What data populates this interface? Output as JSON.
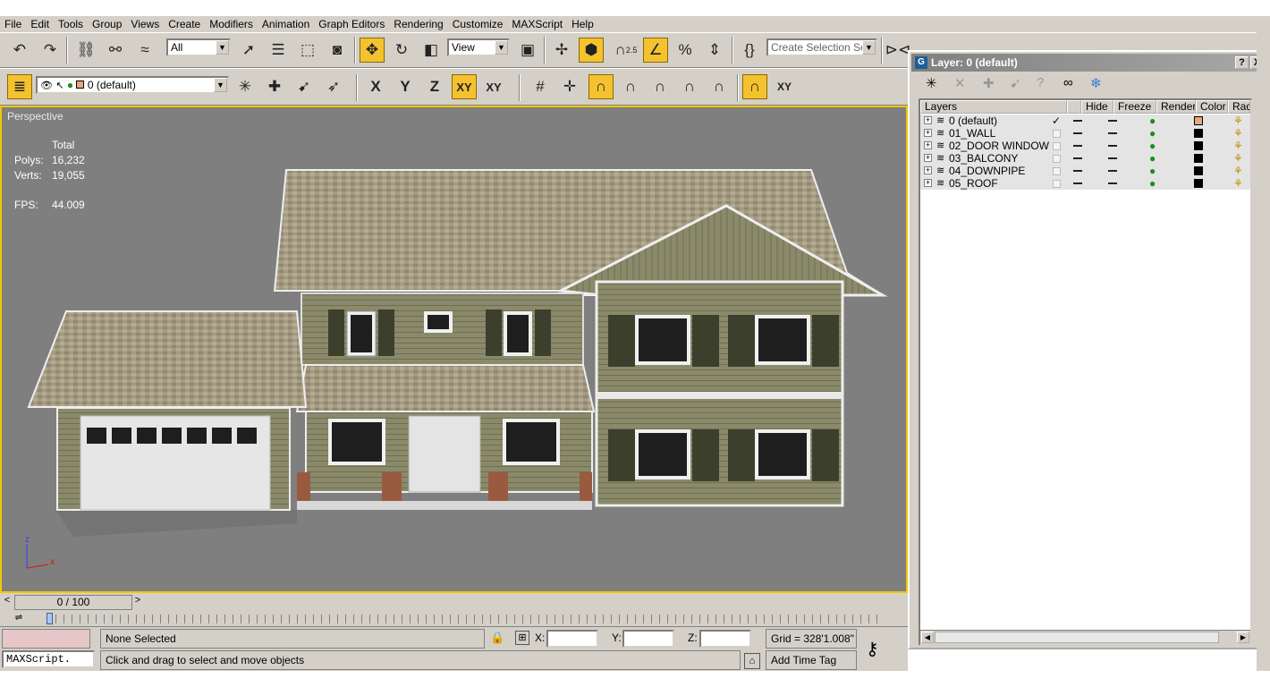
{
  "menu": [
    "File",
    "Edit",
    "Tools",
    "Group",
    "Views",
    "Create",
    "Modifiers",
    "Animation",
    "Graph Editors",
    "Rendering",
    "Customize",
    "MAXScript",
    "Help"
  ],
  "toolbar1": {
    "selection_filter": "All",
    "ref_coord": "View",
    "create_selection_set": "Create Selection Set",
    "snap_label": "2.5"
  },
  "toolbar2": {
    "current_layer": "0 (default)",
    "axis_labels": [
      "X",
      "Y",
      "Z",
      "XY",
      "XY"
    ]
  },
  "viewport": {
    "label": "Perspective",
    "stats_header": "Total",
    "polys_label": "Polys:",
    "polys": "16,232",
    "verts_label": "Verts:",
    "verts": "19,055",
    "fps_label": "FPS:",
    "fps": "44.009",
    "axis_z": "z",
    "axis_x": "x"
  },
  "timeline": {
    "position": "0 / 100",
    "prev": "<",
    "next": ">"
  },
  "status": {
    "selection": "None Selected",
    "prompt": "Click and drag to select and move objects",
    "maxscript": "MAXScript.",
    "x_label": "X:",
    "y_label": "Y:",
    "z_label": "Z:",
    "grid": "Grid = 328'1.008\"",
    "add_time_tag": "Add Time Tag"
  },
  "layer_panel": {
    "title": "Layer: 0 (default)",
    "help": "?",
    "close": "X",
    "columns": [
      "Layers",
      "Hide",
      "Freeze",
      "Render",
      "Color",
      "Radios"
    ],
    "rows": [
      {
        "name": "0 (default)",
        "current": true,
        "color": "#e8a67e"
      },
      {
        "name": "01_WALL",
        "current": false,
        "color": "#000000"
      },
      {
        "name": "02_DOOR WINDOW",
        "current": false,
        "color": "#000000"
      },
      {
        "name": "03_BALCONY",
        "current": false,
        "color": "#000000"
      },
      {
        "name": "04_DOWNPIPE",
        "current": false,
        "color": "#000000"
      },
      {
        "name": "05_ROOF",
        "current": false,
        "color": "#000000"
      }
    ]
  },
  "colors": {
    "ui_gray": "#d4d0c8",
    "viewport_bg": "#7f7f7f",
    "active_highlight": "#f4c22f",
    "viewport_border": "#f0c800",
    "wall_green": "#8a8a6a",
    "roof_tan": "#a89e84",
    "shutter_dark": "#3c3f2c"
  }
}
